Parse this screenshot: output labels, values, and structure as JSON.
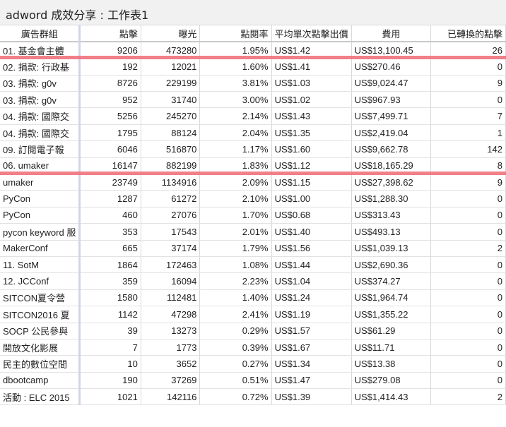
{
  "window": {
    "title": "adword 成效分享 : 工作表1"
  },
  "table": {
    "columns": [
      "廣告群組",
      "點擊",
      "曝光",
      "點閱率",
      "平均單次點擊出價",
      "費用",
      "已轉換的點擊"
    ],
    "rows": [
      [
        "01. 基金會主體",
        "9206",
        "473280",
        "1.95%",
        "US$1.42",
        "US$13,100.45",
        "26"
      ],
      [
        "02. 捐款: 行政基",
        "192",
        "12021",
        "1.60%",
        "US$1.41",
        "US$270.46",
        "0"
      ],
      [
        "03. 捐款: g0v",
        "8726",
        "229199",
        "3.81%",
        "US$1.03",
        "US$9,024.47",
        "9"
      ],
      [
        "03. 捐款: g0v",
        "952",
        "31740",
        "3.00%",
        "US$1.02",
        "US$967.93",
        "0"
      ],
      [
        "04. 捐款: 國際交",
        "5256",
        "245270",
        "2.14%",
        "US$1.43",
        "US$7,499.71",
        "7"
      ],
      [
        "04. 捐款: 國際交",
        "1795",
        "88124",
        "2.04%",
        "US$1.35",
        "US$2,419.04",
        "1"
      ],
      [
        "09. 訂閱電子報",
        "6046",
        "516870",
        "1.17%",
        "US$1.60",
        "US$9,662.78",
        "142"
      ],
      [
        "06. umaker",
        "16147",
        "882199",
        "1.83%",
        "US$1.12",
        "US$18,165.29",
        "8"
      ],
      [
        "umaker",
        "23749",
        "1134916",
        "2.09%",
        "US$1.15",
        "US$27,398.62",
        "9"
      ],
      [
        "PyCon",
        "1287",
        "61272",
        "2.10%",
        "US$1.00",
        "US$1,288.30",
        "0"
      ],
      [
        "PyCon",
        "460",
        "27076",
        "1.70%",
        "US$0.68",
        "US$313.43",
        "0"
      ],
      [
        "pycon keyword 服",
        "353",
        "17543",
        "2.01%",
        "US$1.40",
        "US$493.13",
        "0"
      ],
      [
        "MakerConf",
        "665",
        "37174",
        "1.79%",
        "US$1.56",
        "US$1,039.13",
        "2"
      ],
      [
        "11. SotM",
        "1864",
        "172463",
        "1.08%",
        "US$1.44",
        "US$2,690.36",
        "0"
      ],
      [
        "12. JCConf",
        "359",
        "16094",
        "2.23%",
        "US$1.04",
        "US$374.27",
        "0"
      ],
      [
        "SITCON夏令營",
        "1580",
        "112481",
        "1.40%",
        "US$1.24",
        "US$1,964.74",
        "0"
      ],
      [
        "SITCON2016 夏",
        "1142",
        "47298",
        "2.41%",
        "US$1.19",
        "US$1,355.22",
        "0"
      ],
      [
        "SOCP 公民參與",
        "39",
        "13273",
        "0.29%",
        "US$1.57",
        "US$61.29",
        "0"
      ],
      [
        "開放文化影展",
        "7",
        "1773",
        "0.39%",
        "US$1.67",
        "US$11.71",
        "0"
      ],
      [
        "民主的數位空間",
        "10",
        "3652",
        "0.27%",
        "US$1.34",
        "US$13.38",
        "0"
      ],
      [
        "dbootcamp",
        "190",
        "37269",
        "0.51%",
        "US$1.47",
        "US$279.08",
        "0"
      ],
      [
        "活動 : ELC 2015",
        "1021",
        "142116",
        "0.72%",
        "US$1.39",
        "US$1,414.43",
        "2"
      ]
    ]
  },
  "highlights": {
    "color": "#ef6e79",
    "row_indices": [
      0,
      7
    ]
  }
}
